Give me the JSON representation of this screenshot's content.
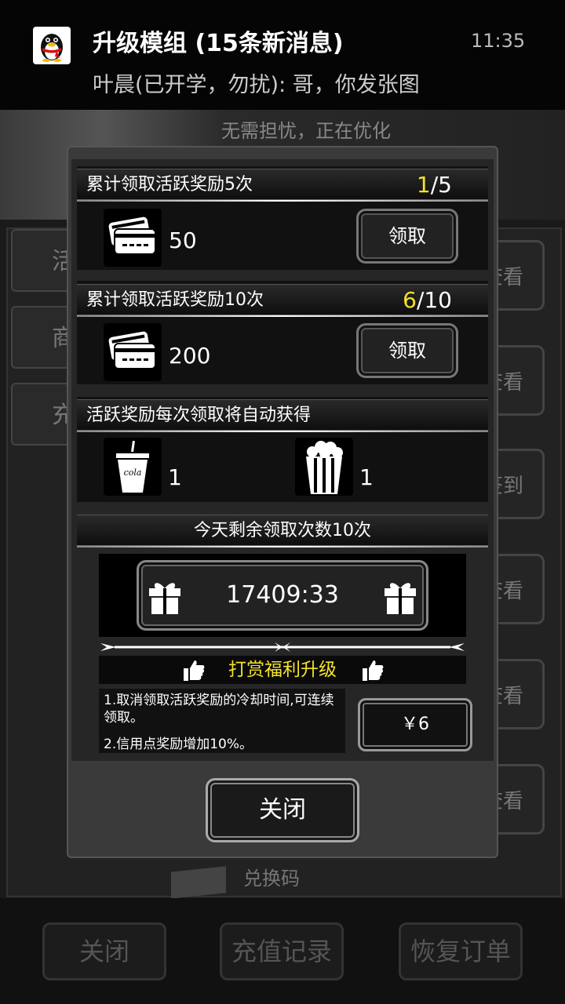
{
  "notification": {
    "app_icon": "qq-penguin-icon",
    "title": "升级模组 (15条新消息)",
    "time": "11:35",
    "message": "叶晨(已开学，勿扰): 哥，你发张图"
  },
  "background": {
    "ghost_text": "无需担忧，正在优化",
    "tabs": [
      "活",
      "商",
      "充"
    ],
    "side_buttons": [
      "查看",
      "查看",
      "签到",
      "查看",
      "查看",
      "查看"
    ],
    "code_label": "兑换码",
    "bottom_buttons": [
      "关闭",
      "充值记录",
      "恢复订单"
    ]
  },
  "dialog": {
    "reward1": {
      "title": "累计领取活跃奖励5次",
      "current": "1",
      "total": "/5",
      "icon": "credit-cards-icon",
      "amount": "50",
      "button": "领取"
    },
    "reward2": {
      "title": "累计领取活跃奖励10次",
      "current": "6",
      "total": "/10",
      "icon": "credit-cards-icon",
      "amount": "200",
      "button": "领取"
    },
    "auto": {
      "title": "活跃奖励每次领取将自动获得",
      "items": [
        {
          "icon": "cola-cup-icon",
          "cup_text": "cola",
          "count": "1"
        },
        {
          "icon": "popcorn-icon",
          "count": "1"
        }
      ]
    },
    "remaining": "今天剩余领取次数10次",
    "timer": "17409:33",
    "upgrade_title": "打赏福利升级",
    "benefit1": "1.取消领取活跃奖励的冷却时间,可连续领取。",
    "benefit2": "2.信用点奖励增加10%。",
    "price": "￥6",
    "close": "关闭"
  }
}
